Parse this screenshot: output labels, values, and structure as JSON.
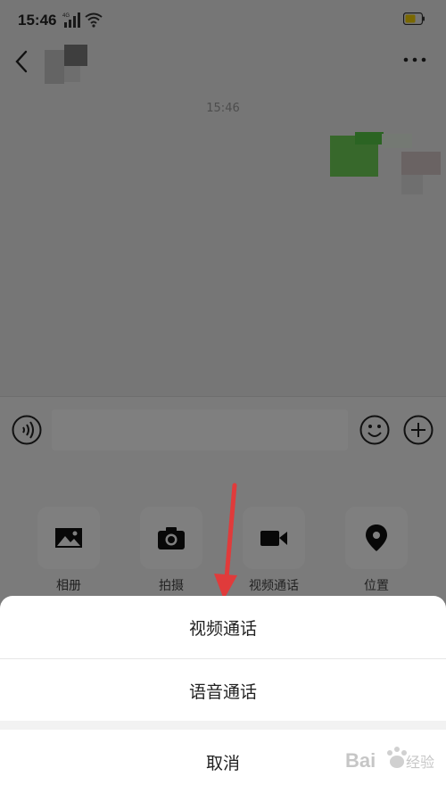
{
  "status": {
    "time": "15:46",
    "network": "4G"
  },
  "chat": {
    "timestamp": "15:46"
  },
  "panel": {
    "items": [
      {
        "label": "相册",
        "icon": "photo-album-icon"
      },
      {
        "label": "拍摄",
        "icon": "camera-icon"
      },
      {
        "label": "视频通话",
        "icon": "video-camera-icon"
      },
      {
        "label": "位置",
        "icon": "location-pin-icon"
      }
    ]
  },
  "sheet": {
    "video_call": "视频通话",
    "voice_call": "语音通话",
    "cancel": "取消"
  },
  "watermark": {
    "text": "Bai du 经验"
  },
  "colors": {
    "accent_green": "#3cb731",
    "arrow_red": "#e03b3b"
  }
}
